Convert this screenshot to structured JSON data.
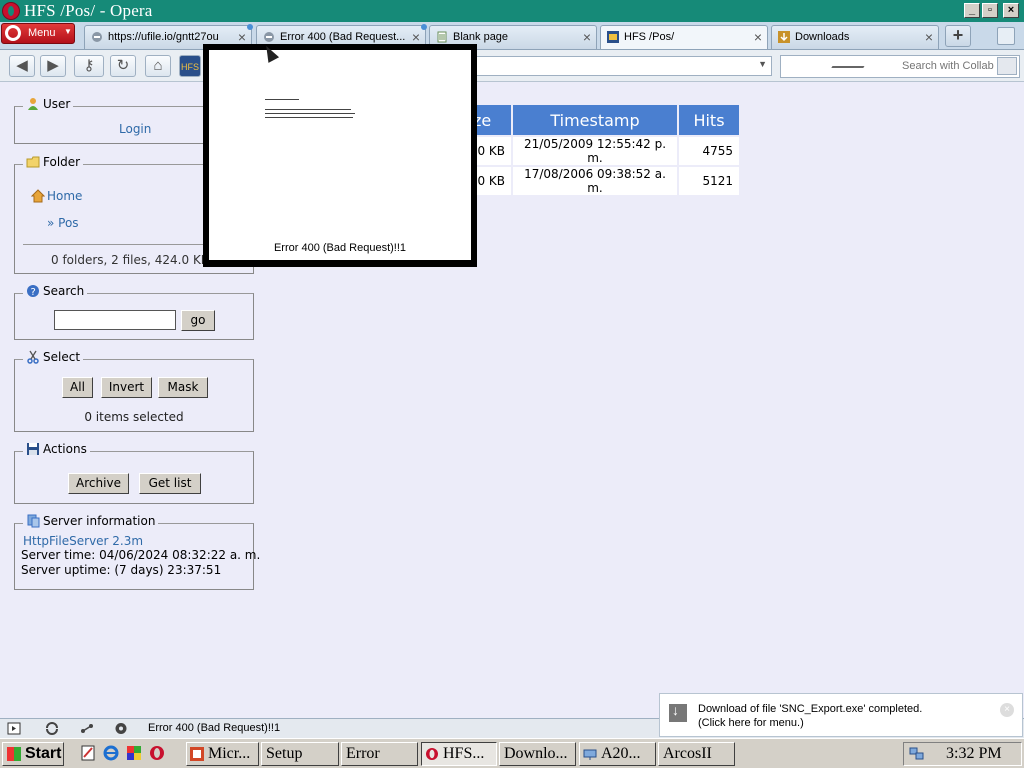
{
  "window": {
    "title": "HFS /Pos/ - Opera"
  },
  "browser": {
    "menu_label": "Menu",
    "tabs": [
      {
        "label": "https://ufile.io/gntt27ou",
        "close": "×"
      },
      {
        "label": "Error 400 (Bad Request...",
        "close": "×"
      },
      {
        "label": "Blank page",
        "close": "×"
      },
      {
        "label": "HFS /Pos/",
        "close": "×"
      },
      {
        "label": "Downloads",
        "close": "×"
      }
    ],
    "new_tab": "+",
    "search_placeholder": "Search with Collab",
    "status_text": "Error 400 (Bad Request)!!1"
  },
  "hfs": {
    "user": {
      "legend": "User",
      "login_link": "Login"
    },
    "folder": {
      "legend": "Folder",
      "home": "Home",
      "current": "» Pos",
      "summary": "0 folders, 2 files, 424.0 KBytes"
    },
    "search": {
      "legend": "Search",
      "value": "",
      "go": "go"
    },
    "select": {
      "legend": "Select",
      "all": "All",
      "invert": "Invert",
      "mask": "Mask",
      "selected": "0 items selected"
    },
    "actions": {
      "legend": "Actions",
      "archive": "Archive",
      "get_list": "Get list"
    },
    "server": {
      "legend": "Server information",
      "version_link": "HttpFileServer 2.3m",
      "time": "Server time: 04/06/2024 08:32:22 a. m.",
      "uptime": "Server uptime: (7 days) 23:37:51"
    },
    "table": {
      "headers": [
        "ze",
        "Timestamp",
        "Hits"
      ],
      "rows": [
        {
          "size": ".0 KB",
          "timestamp": "21/05/2009 12:55:42 p. m.",
          "hits": "4755"
        },
        {
          "size": ".0 KB",
          "timestamp": "17/08/2006 09:38:52 a. m.",
          "hits": "5121"
        }
      ]
    }
  },
  "popup": {
    "caption": "Error 400 (Bad Request)!!1"
  },
  "download_notice": {
    "line1": "Download of file 'SNC_Export.exe' completed.",
    "line2": "(Click here for menu.)"
  },
  "taskbar": {
    "start": "Start",
    "tasks": [
      "Micr...",
      "Setup",
      "Error",
      "HFS...",
      "Downlo...",
      "A20...",
      "ArcosII"
    ],
    "clock": "3:32 PM"
  },
  "colors": {
    "title_bar": "#168a78",
    "table_header": "#4a7fd0",
    "page_bg": "#ececf9",
    "link": "#2f6aa8"
  }
}
